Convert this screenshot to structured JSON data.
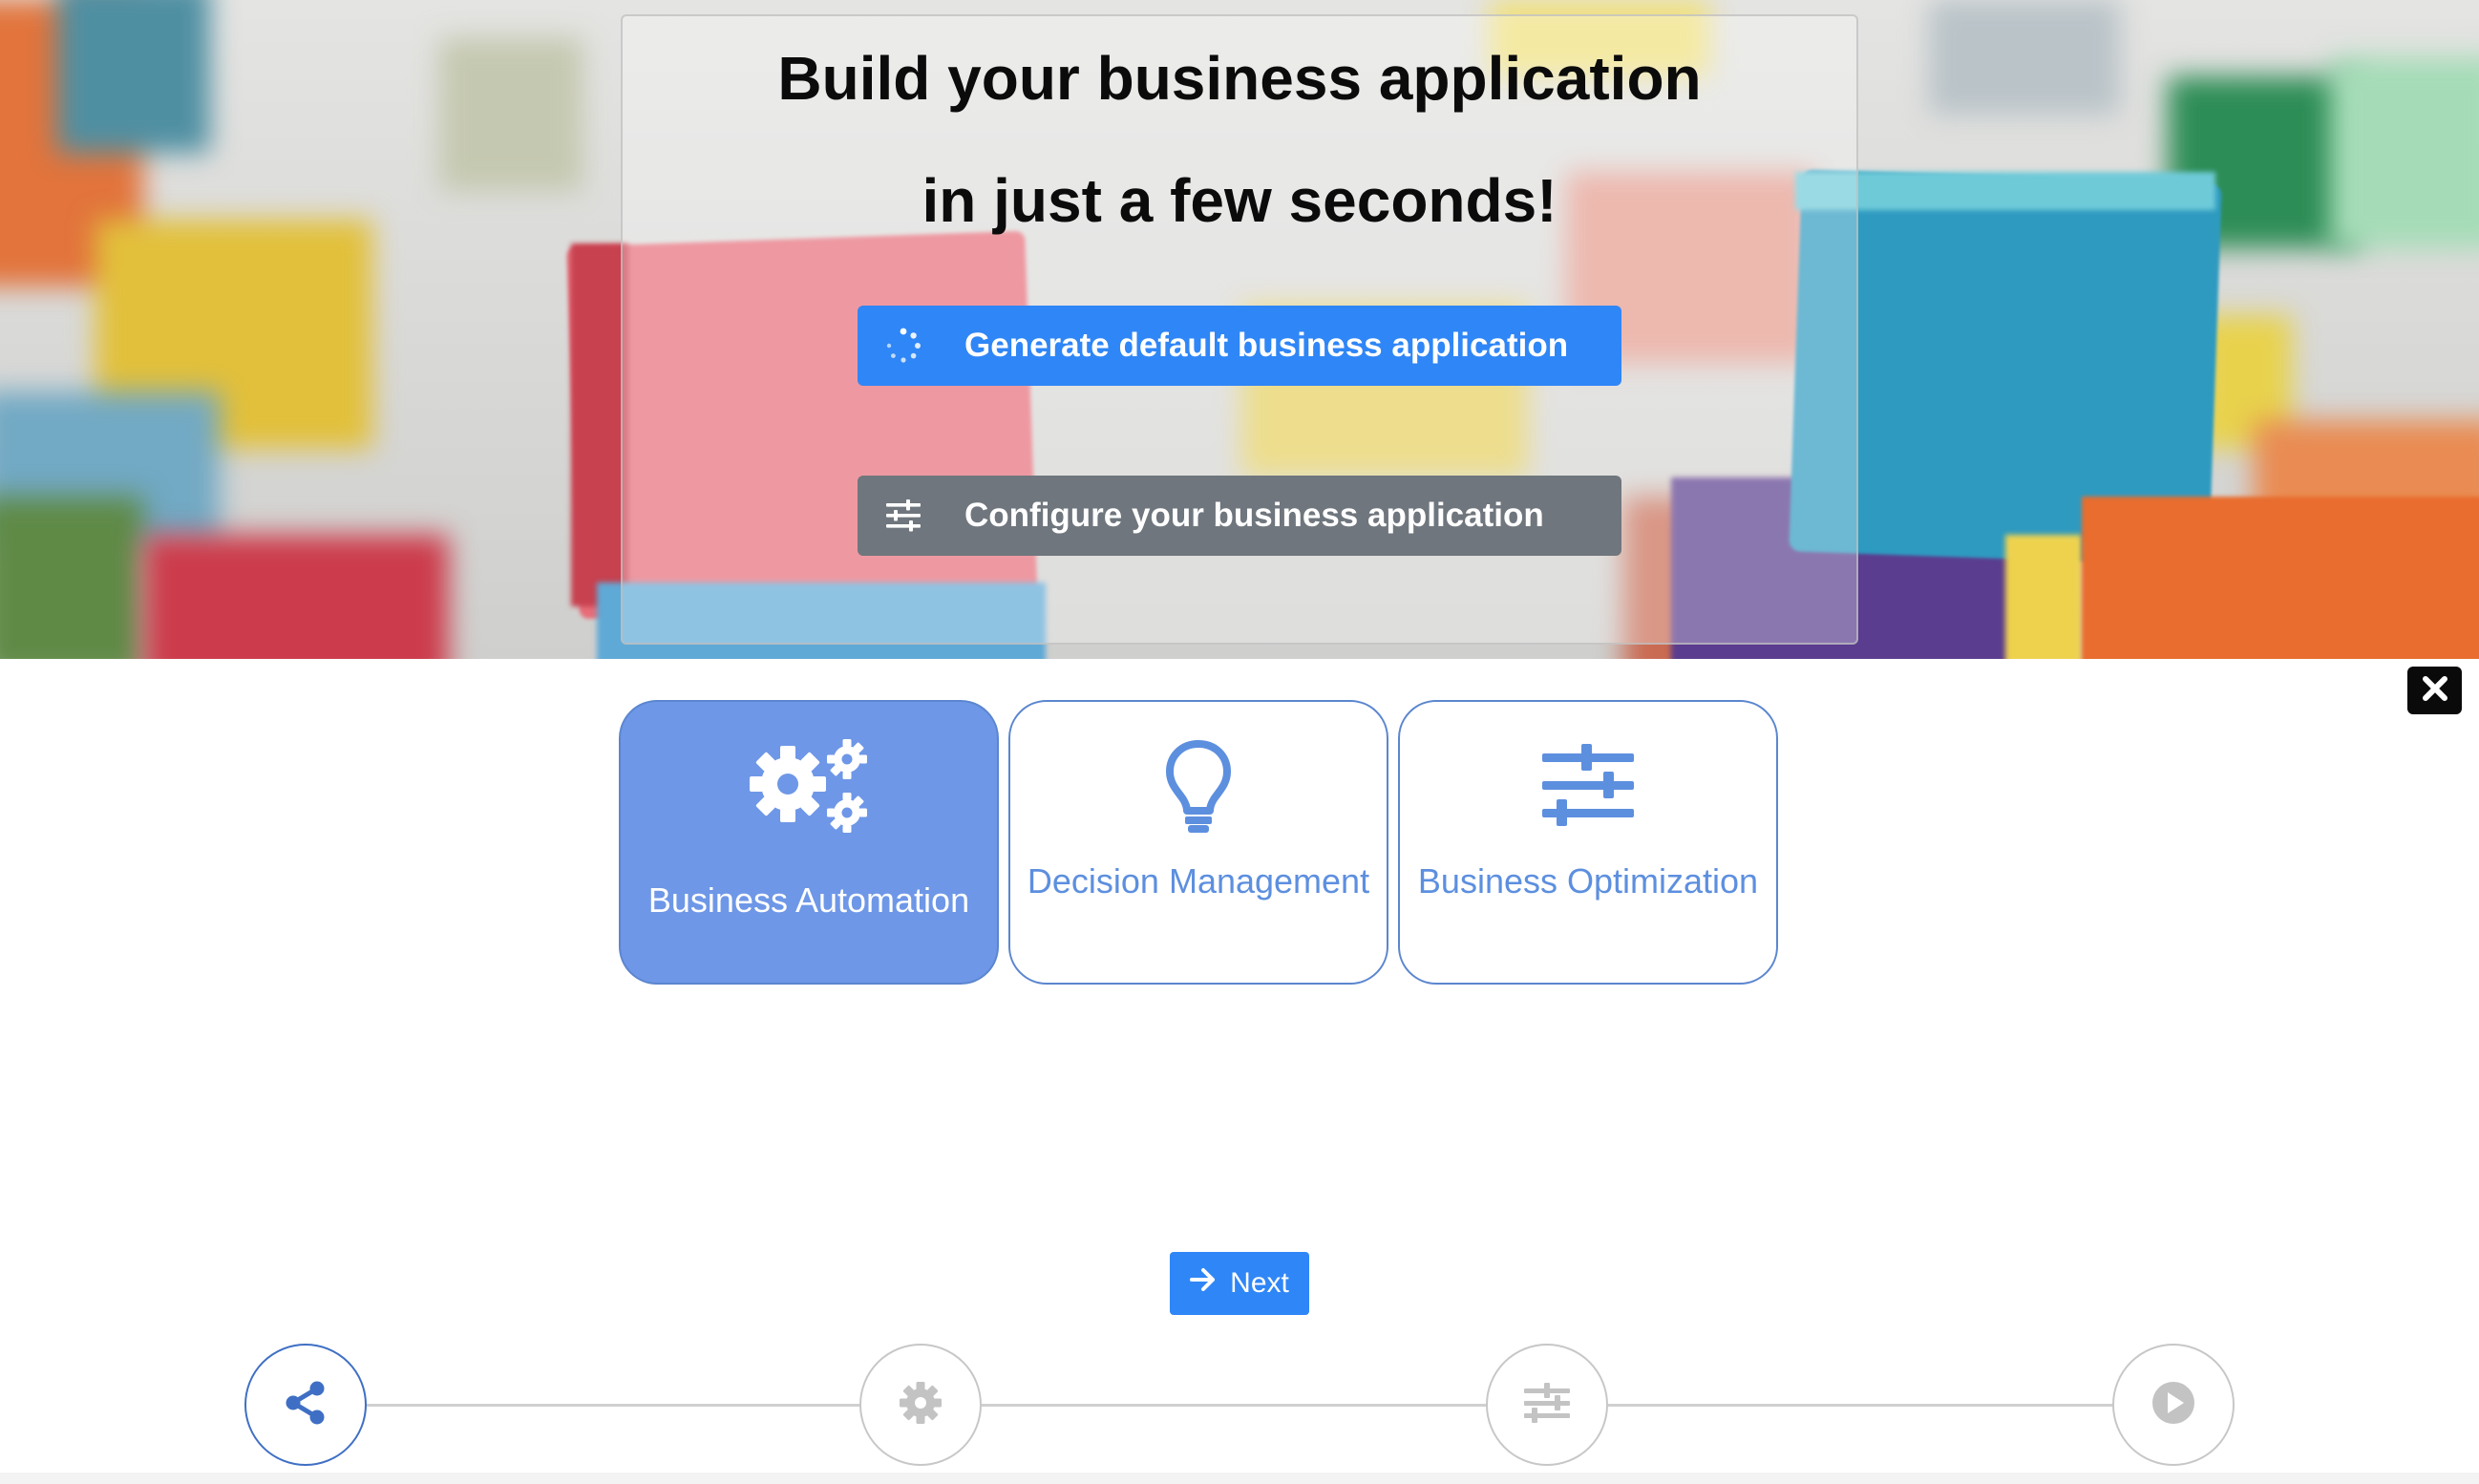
{
  "hero": {
    "title_line1": "Build your business application",
    "title_line2": "in just a few seconds!",
    "generate_label": "Generate default business application",
    "configure_label": "Configure your business application"
  },
  "cards": [
    {
      "label": "Business Automation",
      "icon": "cogs-icon",
      "selected": true
    },
    {
      "label": "Decision Management",
      "icon": "lightbulb-icon",
      "selected": false
    },
    {
      "label": "Business Optimization",
      "icon": "sliders-icon",
      "selected": false
    }
  ],
  "next_label": "Next",
  "stepper": {
    "steps": [
      {
        "icon": "share-icon",
        "active": true
      },
      {
        "icon": "gear-icon",
        "active": false
      },
      {
        "icon": "sliders-icon",
        "active": false
      },
      {
        "icon": "play-icon",
        "active": false
      }
    ]
  },
  "colors": {
    "primary": "#2f86f6",
    "secondary": "#6f767d",
    "card_selected": "#6e97e7",
    "card_border": "#5b86cf",
    "card_text": "#5d8fdf"
  }
}
